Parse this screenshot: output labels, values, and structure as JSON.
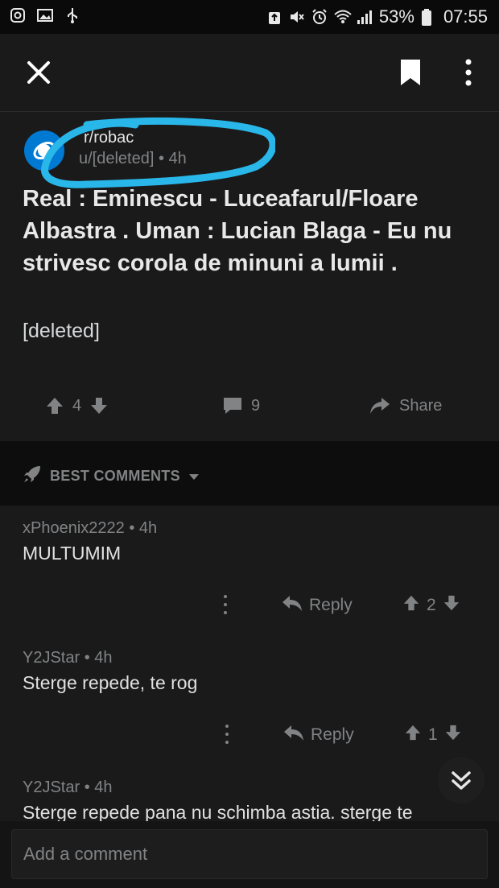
{
  "status_bar": {
    "battery": "53%",
    "time": "07:55",
    "icons": [
      "instagram-icon",
      "gallery-icon",
      "usb-icon",
      "recycle-icon",
      "mute-icon",
      "alarm-icon",
      "wifi-icon",
      "signal-icon",
      "battery-icon"
    ]
  },
  "toolbar": {
    "icons": [
      "close-icon",
      "bookmark-icon",
      "more-options-icon"
    ]
  },
  "post": {
    "subreddit": "r/robac",
    "author": "u/[deleted]",
    "time": "4h",
    "title": "Real : Eminescu - Luceafarul/Floare Albastra . Uman : Lucian Blaga - Eu nu strivesc corola de minuni a lumii .",
    "body": "[deleted]",
    "score": "4",
    "comments_count": "9",
    "share_label": "Share"
  },
  "comments_header": {
    "label": "BEST COMMENTS"
  },
  "comments": [
    {
      "author": "xPhoenix2222",
      "time": "4h",
      "text": "MULTUMIM",
      "reply_label": "Reply",
      "score": "2"
    },
    {
      "author": "Y2JStar",
      "time": "4h",
      "text": "Sterge repede, te rog",
      "reply_label": "Reply",
      "score": "1"
    },
    {
      "author": "Y2JStar",
      "time": "4h",
      "text": "Sterge repede pana nu schimba astia. sterge te"
    }
  ],
  "composer": {
    "placeholder": "Add a comment"
  },
  "colors": {
    "background": "#1a1a1b",
    "subreddit_avatar": "#0079d3",
    "annotation_highlight": "#29b6e8",
    "muted_text": "#818384"
  }
}
